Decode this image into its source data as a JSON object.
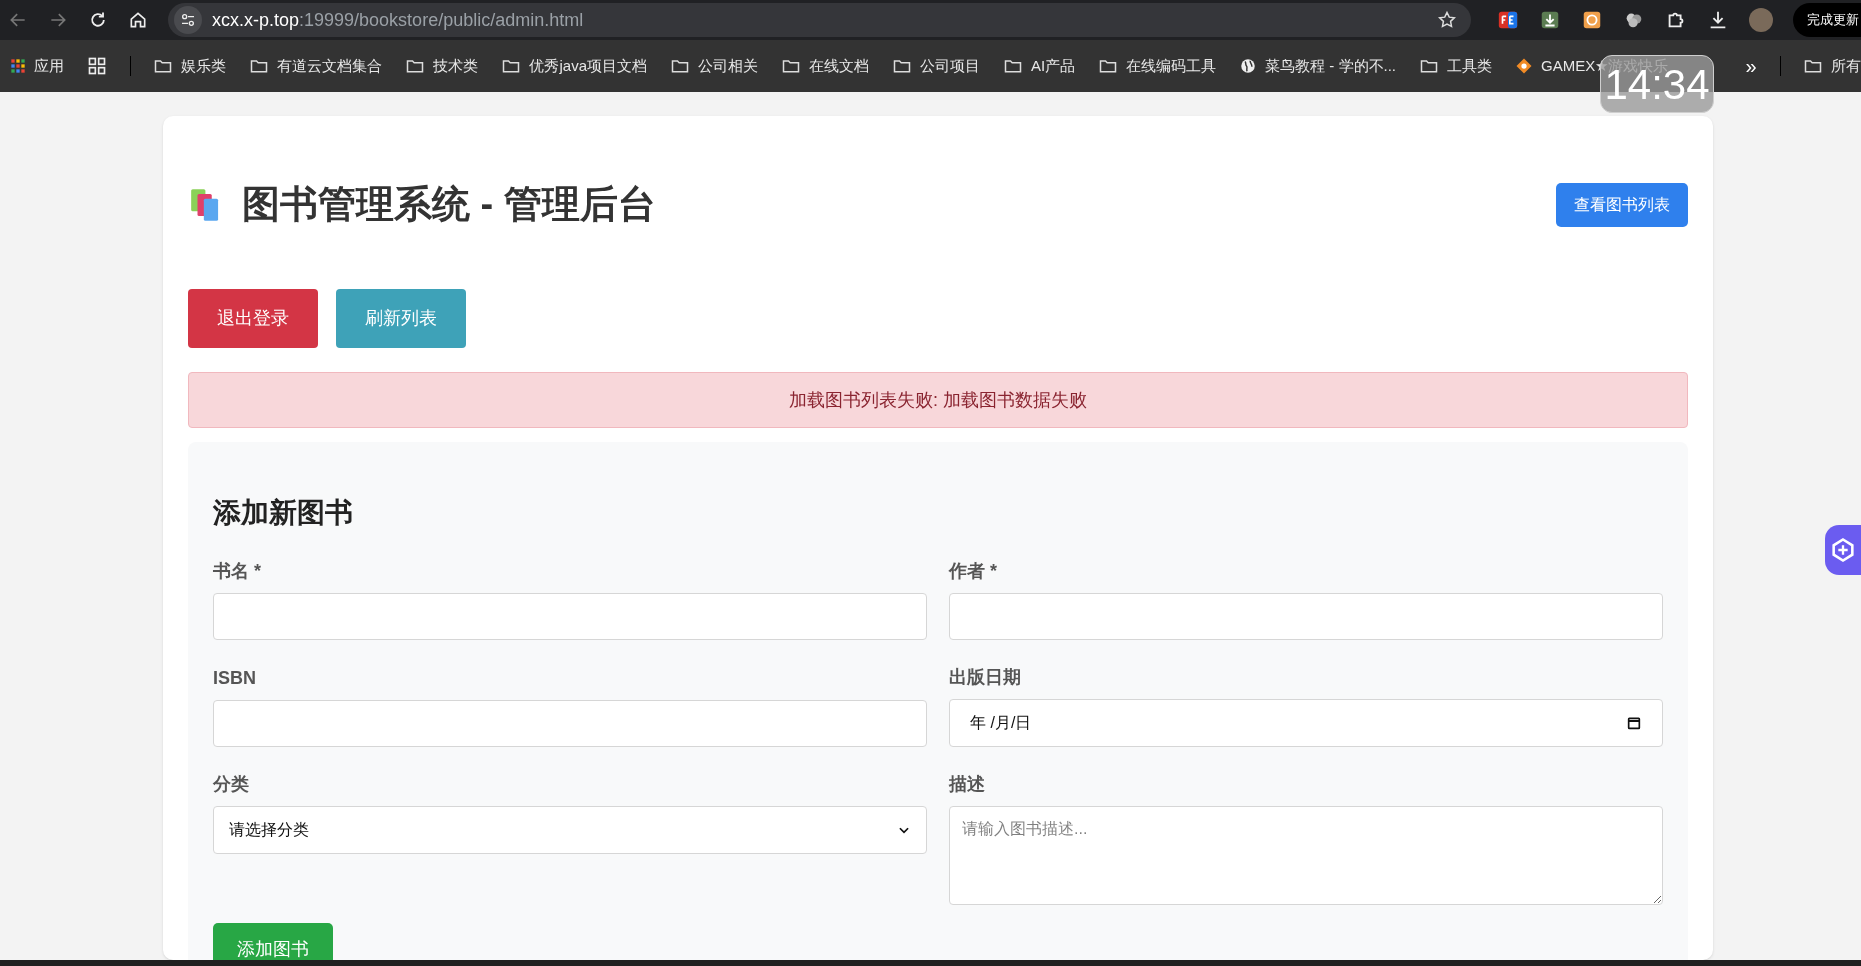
{
  "browser": {
    "url_host": "xcx.x-p.top",
    "url_rest": ":19999/bookstore/public/admin.html",
    "update_button": "完成更新",
    "bookmarks": [
      {
        "kind": "apps",
        "label": "应用"
      },
      {
        "kind": "grid"
      },
      {
        "kind": "folder",
        "label": "娱乐类"
      },
      {
        "kind": "folder",
        "label": "有道云文档集合"
      },
      {
        "kind": "folder",
        "label": "技术类"
      },
      {
        "kind": "folder",
        "label": "优秀java项目文档"
      },
      {
        "kind": "folder",
        "label": "公司相关"
      },
      {
        "kind": "folder",
        "label": "在线文档"
      },
      {
        "kind": "folder",
        "label": "公司项目"
      },
      {
        "kind": "folder",
        "label": "AI产品"
      },
      {
        "kind": "folder",
        "label": "在线编码工具"
      },
      {
        "kind": "globe",
        "label": "菜鸟教程 - 学的不..."
      },
      {
        "kind": "folder",
        "label": "工具类"
      },
      {
        "kind": "game",
        "label": "GAMEX★游戏快乐"
      }
    ],
    "more": "»",
    "all_bookmarks": "所有",
    "clock": "14:34"
  },
  "page": {
    "title": "图书管理系统 - 管理后台",
    "view_list_button": "查看图书列表",
    "actions": [
      {
        "label": "退出登录",
        "color": "#d33545"
      },
      {
        "label": "刷新列表",
        "color": "#3ea2b8"
      }
    ],
    "alert": "加载图书列表失败: 加载图书数据失败",
    "form": {
      "heading": "添加新图书",
      "fields": [
        {
          "kind": "text",
          "label": "书名 *"
        },
        {
          "kind": "text",
          "label": "作者 *"
        },
        {
          "kind": "text",
          "label": "ISBN"
        },
        {
          "kind": "date",
          "label": "出版日期",
          "value": "年 /月/日"
        },
        {
          "kind": "select",
          "label": "分类",
          "value": "请选择分类"
        },
        {
          "kind": "textarea",
          "label": "描述",
          "placeholder": "请输入图书描述..."
        }
      ],
      "submit": "添加图书"
    }
  }
}
